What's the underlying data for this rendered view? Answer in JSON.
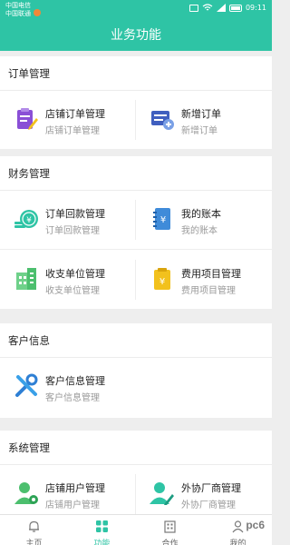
{
  "status_bar": {
    "carrier1": "中国电信",
    "carrier2": "中国联通",
    "time": "09:11"
  },
  "header": {
    "title": "业务功能"
  },
  "sections": [
    {
      "title": "订单管理",
      "items": [
        {
          "label": "店铺订单管理",
          "sub": "店铺订单管理",
          "icon": "clipboard-edit-icon"
        },
        {
          "label": "新增订单",
          "sub": "新增订单",
          "icon": "order-add-icon"
        }
      ]
    },
    {
      "title": "财务管理",
      "items": [
        {
          "label": "订单回款管理",
          "sub": "订单回款管理",
          "icon": "coins-icon"
        },
        {
          "label": "我的账本",
          "sub": "我的账本",
          "icon": "ledger-book-icon"
        },
        {
          "label": "收支单位管理",
          "sub": "收支单位管理",
          "icon": "building-icon"
        },
        {
          "label": "费用项目管理",
          "sub": "费用项目管理",
          "icon": "expense-clipboard-icon"
        }
      ]
    },
    {
      "title": "客户信息",
      "items": [
        {
          "label": "客户信息管理",
          "sub": "客户信息管理",
          "icon": "tools-icon"
        }
      ]
    },
    {
      "title": "系统管理",
      "items": [
        {
          "label": "店铺用户管理",
          "sub": "店铺用户管理",
          "icon": "user-gear-icon"
        },
        {
          "label": "外协厂商管理",
          "sub": "外协厂商管理",
          "icon": "user-edit-icon"
        }
      ]
    }
  ],
  "tabbar": {
    "items": [
      {
        "label": "主页",
        "icon": "bell-icon"
      },
      {
        "label": "功能",
        "icon": "grid-icon"
      },
      {
        "label": "合作",
        "icon": "building-icon"
      },
      {
        "label": "我的",
        "icon": "profile-icon"
      }
    ],
    "active_index": 1
  },
  "watermark": "pc6",
  "colors": {
    "accent": "#2ec4a5",
    "purple": "#8a4fd6",
    "blue": "#3f8bd9",
    "green": "#2ec4a5",
    "yellow": "#f2c11d"
  }
}
